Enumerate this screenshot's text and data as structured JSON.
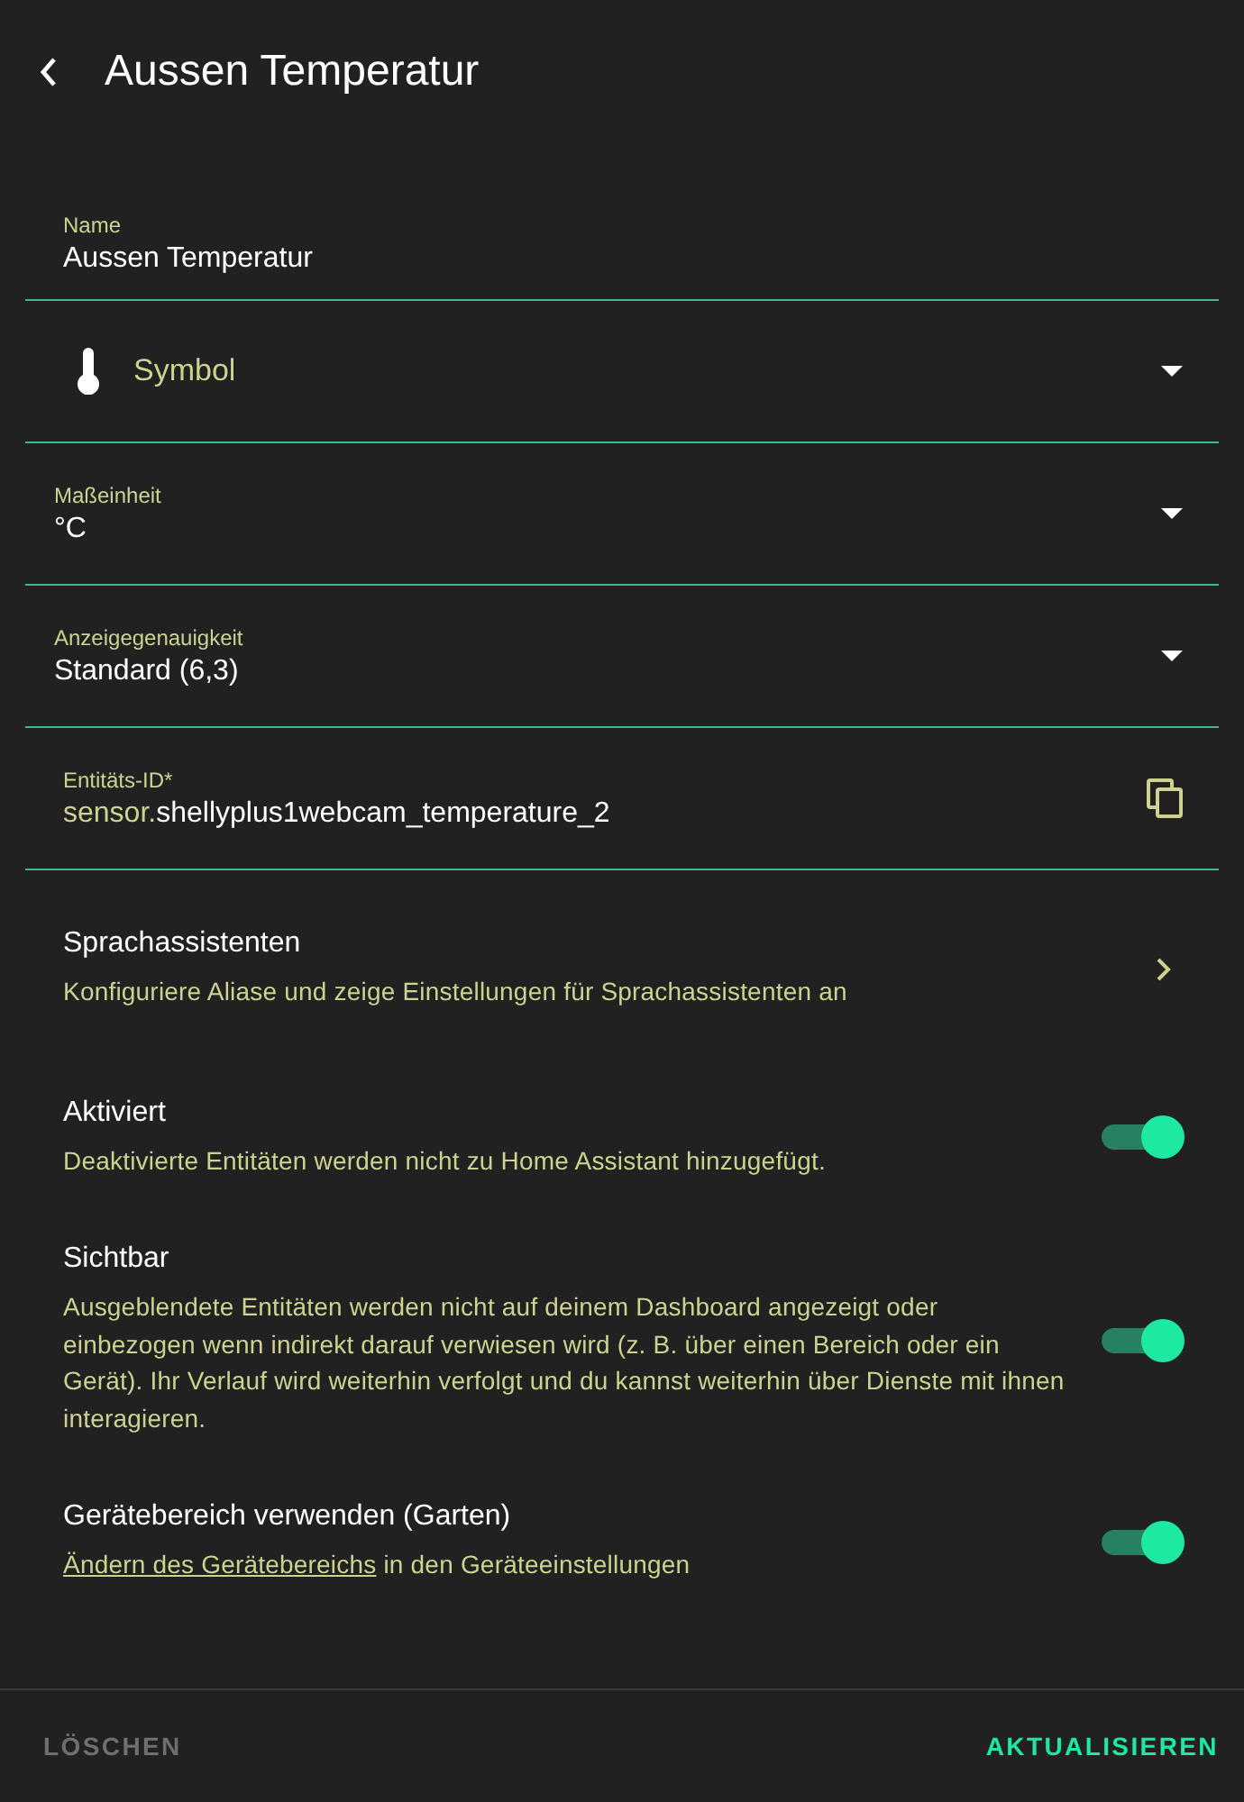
{
  "header": {
    "title": "Aussen Temperatur"
  },
  "fields": [
    {
      "kind": "text",
      "label": "Name",
      "value": "Aussen Temperatur"
    },
    {
      "kind": "icon-select",
      "placeholder": "Symbol"
    },
    {
      "kind": "select",
      "label": "Maßeinheit",
      "value": "°C"
    },
    {
      "kind": "select",
      "label": "Anzeigegenauigkeit",
      "value": "Standard (6,3)"
    },
    {
      "kind": "entity",
      "label": "Entitäts-ID*",
      "prefix": "sensor.",
      "value": "shellyplus1webcam_temperature_2"
    }
  ],
  "nav_row": {
    "title": "Sprachassistenten",
    "description": "Konfiguriere Aliase und zeige Einstellungen für Sprachassistenten an"
  },
  "settings": [
    {
      "title": "Aktiviert",
      "description": "Deaktivierte Entitäten werden nicht zu Home Assistant hinzugefügt.",
      "on": true
    },
    {
      "title": "Sichtbar",
      "description": "Ausgeblendete Entitäten werden nicht auf deinem Dashboard angezeigt oder einbezogen wenn indirekt darauf verwiesen wird (z. B. über einen Bereich oder ein Gerät). Ihr Verlauf wird weiterhin verfolgt und du kannst weiterhin über Dienste mit ihnen interagieren.",
      "on": true
    },
    {
      "title": "Gerätebereich verwenden (Garten)",
      "link": "Ändern des Gerätebereichs",
      "description": "in den Geräteeinstellungen",
      "on": true
    }
  ],
  "footer": {
    "buttons": [
      {
        "label": "LÖSCHEN",
        "kind": "secondary"
      },
      {
        "label": "AKTUALISIEREN",
        "kind": "primary"
      }
    ]
  }
}
